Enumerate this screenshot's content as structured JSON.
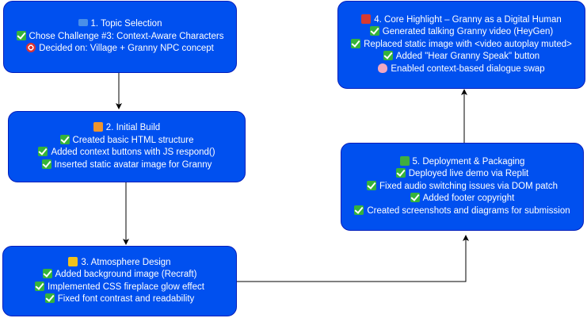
{
  "nodes": {
    "topic": {
      "title_icon": "blue-square-icon",
      "title": "1. Topic Selection",
      "lines": [
        {
          "icon": "check-icon",
          "text": "Chose Challenge #3: Context-Aware Characters"
        },
        {
          "icon": "dart-icon",
          "text": "Decided on: Village + Granny NPC concept"
        }
      ]
    },
    "build": {
      "title_icon": "orange-square-icon",
      "title": "2. Initial Build",
      "lines": [
        {
          "icon": "check-icon",
          "text": "Created basic HTML structure"
        },
        {
          "icon": "check-icon",
          "text": "Added context buttons with JS respond()"
        },
        {
          "icon": "check-icon",
          "text": "Inserted static avatar image for Granny"
        }
      ]
    },
    "atmosphere": {
      "title_icon": "yellow-square-icon",
      "title": "3. Atmosphere Design",
      "lines": [
        {
          "icon": "check-icon",
          "text": "Added background image (Recraft)"
        },
        {
          "icon": "check-icon",
          "text": "Implemented CSS fireplace glow effect"
        },
        {
          "icon": "check-icon",
          "text": "Fixed font contrast and readability"
        }
      ]
    },
    "highlight": {
      "title_icon": "red-square-icon",
      "title": "4. Core Highlight – Granny as a Digital Human",
      "lines": [
        {
          "icon": "check-icon",
          "text": "Generated talking Granny video (HeyGen)"
        },
        {
          "icon": "check-icon",
          "text": "Replaced static image with <video autoplay muted>"
        },
        {
          "icon": "check-icon",
          "text": "Added \"Hear Granny Speak\" button"
        },
        {
          "icon": "brain-icon",
          "text": "Enabled context-based dialogue swap"
        }
      ]
    },
    "deploy": {
      "title_icon": "green-square-icon",
      "title": "5. Deployment & Packaging",
      "lines": [
        {
          "icon": "check-icon",
          "text": "Deployed live demo via Replit"
        },
        {
          "icon": "check-icon",
          "text": "Fixed audio switching issues via DOM patch"
        },
        {
          "icon": "check-icon",
          "text": "Added footer copyright"
        },
        {
          "icon": "check-icon",
          "text": "Created screenshots and diagrams for submission"
        }
      ]
    }
  }
}
